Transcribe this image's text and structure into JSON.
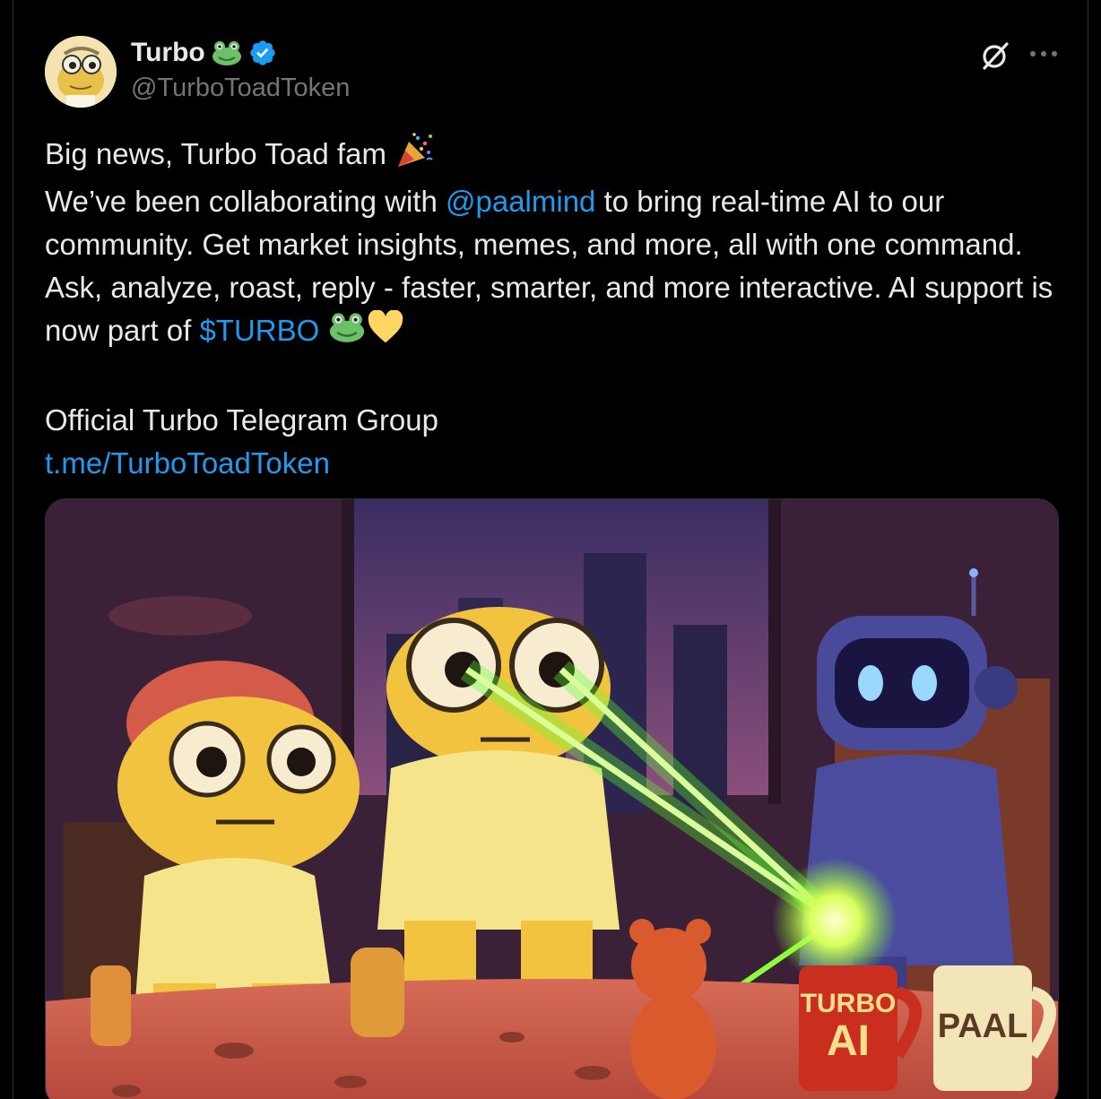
{
  "author": {
    "display_name": "Turbo",
    "handle": "@TurboToadToken",
    "verified": true,
    "avatar_icon": "toad-avatar-icon",
    "name_emoji": "frog-face-icon"
  },
  "actions": {
    "grok_icon": "grok-icon",
    "more_icon": "more-options-icon"
  },
  "post": {
    "line1_text": "Big news, Turbo Toad fam ",
    "line1_emoji": "party-popper-icon",
    "line2_before": "We’ve been collaborating with ",
    "mention": "@paalmind",
    "line2_after": " to bring real-time AI to our community. Get market insights, memes, and more, all with one command. Ask, analyze, roast, reply - faster, smarter, and more interactive. AI support is now part of ",
    "cashtag": "$TURBO",
    "end_emojis": [
      "frog-face-icon",
      "yellow-heart-icon"
    ],
    "telegram_label": "Official Turbo Telegram Group",
    "telegram_link": "t.me/TurboToadToken"
  },
  "media": {
    "image_icon": "cartoon-frogs-robot-laser-image",
    "mug_left_line1": "TURBO",
    "mug_left_line2": "AI",
    "mug_right_text": "PAAL"
  },
  "colors": {
    "background": "#000000",
    "text": "#e7e9ea",
    "secondary": "#71767b",
    "link": "#1d9bf0",
    "verified": "#1d9bf0"
  }
}
